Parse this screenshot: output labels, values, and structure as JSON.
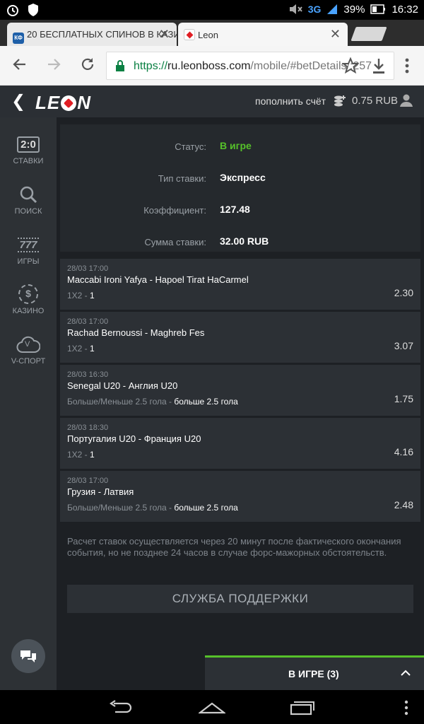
{
  "status_bar": {
    "network": "3G",
    "battery": "39%",
    "time": "16:32"
  },
  "tabs": [
    {
      "title": "20 БЕСПЛАТНЫХ СПИНОВ В КАЗИ",
      "favicon_text": "КФ"
    },
    {
      "title": "Leon"
    }
  ],
  "url": {
    "scheme": "https://",
    "host": "ru.leonboss.com",
    "path": "/mobile/#betDetails/:257"
  },
  "header": {
    "logo_left": "LE",
    "logo_right": "N",
    "topup_label": "пополнить счёт",
    "balance": "0.75 RUB"
  },
  "sidebar": {
    "items": [
      {
        "label": "СТАВКИ",
        "icon_text": "2:0"
      },
      {
        "label": "ПОИСК"
      },
      {
        "label": "ИГРЫ",
        "icon_text": "777"
      },
      {
        "label": "КАЗИНО",
        "icon_text": "$"
      },
      {
        "label": "V-СПОРТ",
        "icon_text": "V"
      }
    ]
  },
  "summary": {
    "status_label": "Статус:",
    "status_value": "В игре",
    "type_label": "Тип ставки:",
    "type_value": "Экспресс",
    "coef_label": "Коэффициент:",
    "coef_value": "127.48",
    "stake_label": "Сумма ставки:",
    "stake_value": "32.00 RUB"
  },
  "bets": [
    {
      "datetime": "28/03 17:00",
      "match": "Maccabi Ironi Yafya - Hapoel Tirat HaCarmel",
      "market": "1X2 - ",
      "selection": "1",
      "odds": "2.30"
    },
    {
      "datetime": "28/03 17:00",
      "match": "Rachad Bernoussi - Maghreb Fes",
      "market": "1X2 - ",
      "selection": "1",
      "odds": "3.07"
    },
    {
      "datetime": "28/03 16:30",
      "match": "Senegal U20 - Англия U20",
      "market": "Больше/Меньше 2.5 гола - ",
      "selection": "больше 2.5 гола",
      "odds": "1.75"
    },
    {
      "datetime": "28/03 18:30",
      "match": "Португалия U20 - Франция U20",
      "market": "1X2 - ",
      "selection": "1",
      "odds": "4.16"
    },
    {
      "datetime": "28/03 17:00",
      "match": "Грузия - Латвия",
      "market": "Больше/Меньше 2.5 гола - ",
      "selection": "больше 2.5 гола",
      "odds": "2.48"
    }
  ],
  "note": "Расчет ставок осуществляется через 20 минут после фактического окончания события, но не позднее 24 часов в случае форс-мажорных обстоятельств.",
  "support_button": "СЛУЖБА ПОДДЕРЖКИ",
  "ingame_panel": "В ИГРЕ (3)",
  "colors": {
    "accent_green": "#56c12a",
    "brand_red": "#e01e24",
    "background": "#1d2024"
  }
}
